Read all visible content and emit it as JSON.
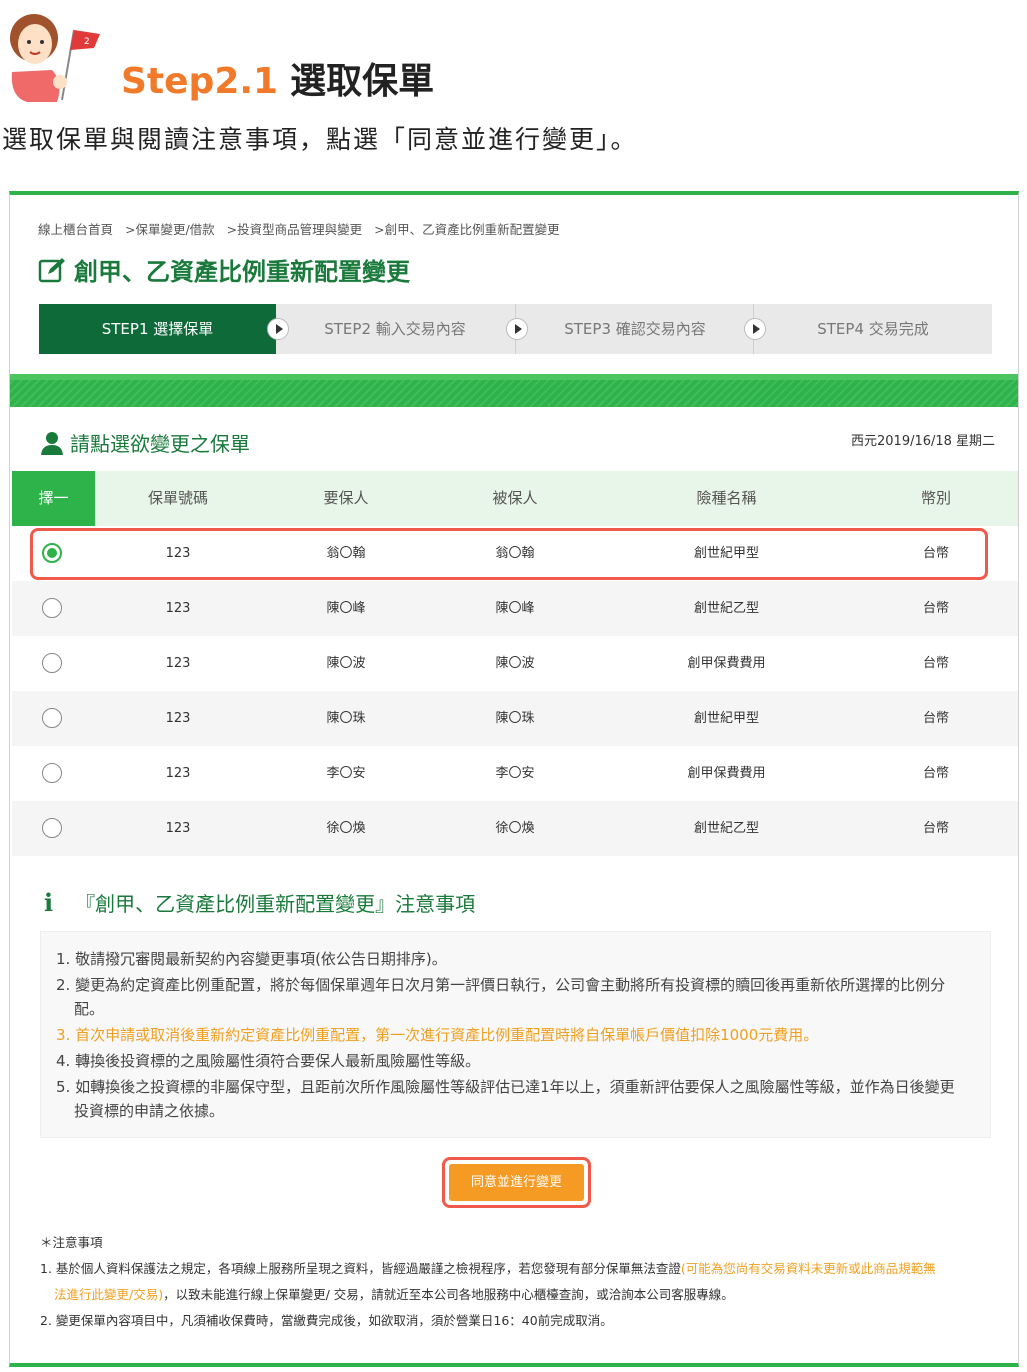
{
  "header": {
    "step_badge": "2",
    "step_number": "Step2.1",
    "step_text": "選取保單",
    "intro": "選取保單與閱讀注意事項，點選「同意並進行變更」。"
  },
  "breadcrumb": [
    "線上櫃台首頁",
    ">保單變更/借款",
    ">投資型商品管理與變更",
    ">創甲、乙資產比例重新配置變更"
  ],
  "page_title": "創甲、乙資產比例重新配置變更",
  "stepper": [
    "STEP1 選擇保單",
    "STEP2 輸入交易內容",
    "STEP3 確認交易內容",
    "STEP4 交易完成"
  ],
  "section": {
    "title": "請點選欲變更之保單",
    "date": "西元2019/16/18 星期二"
  },
  "table": {
    "headers": [
      "擇一",
      "保單號碼",
      "要保人",
      "被保人",
      "險種名稱",
      "幣別"
    ],
    "rows": [
      {
        "policy": "123",
        "applicant": "翁〇翰",
        "insured": "翁〇翰",
        "product": "創世紀甲型",
        "currency": "台幣",
        "selected": true
      },
      {
        "policy": "123",
        "applicant": "陳〇峰",
        "insured": "陳〇峰",
        "product": "創世紀乙型",
        "currency": "台幣",
        "selected": false
      },
      {
        "policy": "123",
        "applicant": "陳〇波",
        "insured": "陳〇波",
        "product": "創甲保費費用",
        "currency": "台幣",
        "selected": false
      },
      {
        "policy": "123",
        "applicant": "陳〇珠",
        "insured": "陳〇珠",
        "product": "創世紀甲型",
        "currency": "台幣",
        "selected": false
      },
      {
        "policy": "123",
        "applicant": "李〇安",
        "insured": "李〇安",
        "product": "創甲保費費用",
        "currency": "台幣",
        "selected": false
      },
      {
        "policy": "123",
        "applicant": "徐〇煥",
        "insured": "徐〇煥",
        "product": "創世紀乙型",
        "currency": "台幣",
        "selected": false
      }
    ]
  },
  "notes": {
    "title": "『創甲、乙資產比例重新配置變更』注意事項",
    "items": [
      "1. 敬請撥冗審閱最新契約內容變更事項(依公告日期排序)。",
      "2. 變更為約定資產比例重配置，將於每個保單週年日次月第一評價日執行，公司會主動將所有投資標的贖回後再重新依所選擇的比例分",
      "配。",
      "3. 首次申請或取消後重新約定資產比例重配置，第一次進行資產比例重配置時將自保單帳戶價值扣除1000元費用。",
      "4. 轉換後投資標的之風險屬性須符合要保人最新風險屬性等級。",
      "5. 如轉換後之投資標的非屬保守型，且距前次所作風險屬性等級評估已達1年以上，須重新評估要保人之風險屬性等級，並作為日後變更",
      "投資標的申請之依據。"
    ]
  },
  "agree_button": "同意並進行變更",
  "footnotes": {
    "title": "＊注意事項",
    "item1_a": "1. 基於個人資料保護法之規定，各項線上服務所呈現之資料，皆經過嚴謹之檢視程序，若您發現有部分保單無法查證",
    "item1_orange1": "(可能為您尚有交易資料未更新或此商品規範無",
    "item1_orange2": "法進行此變更/交易)",
    "item1_b": "，以致未能進行線上保單變更/ 交易，請就近至本公司各地服務中心櫃檯查詢，或洽詢本公司客服專線。",
    "item2": "2. 變更保單內容項目中，凡須補收保費時，當繳費完成後，如欲取消，須於營業日16：40前完成取消。"
  },
  "colors": {
    "brand_green": "#2db34a",
    "dark_green": "#0f6a3a",
    "accent_orange": "#f59a23",
    "highlight_red": "#f05a4a"
  }
}
